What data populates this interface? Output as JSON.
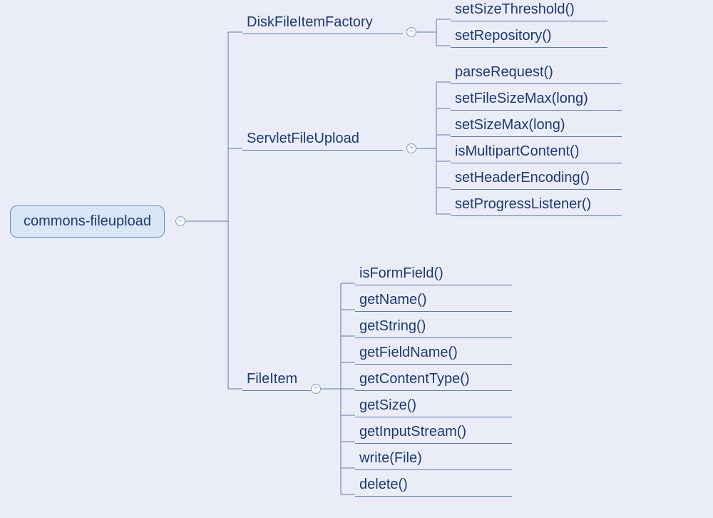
{
  "root": {
    "label": "commons-fileupload"
  },
  "branches": [
    {
      "label": "DiskFileItemFactory",
      "leaves": [
        "setSizeThreshold()",
        "setRepository()"
      ]
    },
    {
      "label": "ServletFileUpload",
      "leaves": [
        "parseRequest()",
        "setFileSizeMax(long)",
        "setSizeMax(long)",
        "isMultipartContent()",
        "setHeaderEncoding()",
        "setProgressListener()"
      ]
    },
    {
      "label": "FileItem",
      "leaves": [
        "isFormField()",
        "getName()",
        "getString()",
        "getFieldName()",
        "getContentType()",
        "getSize()",
        "getInputStream()",
        "write(File)",
        "delete()"
      ]
    }
  ],
  "colors": {
    "bg": "#eaedf7",
    "nodeFill": "#d9e6f7",
    "line": "#5e7aa3",
    "text": "#1f3a6e"
  }
}
